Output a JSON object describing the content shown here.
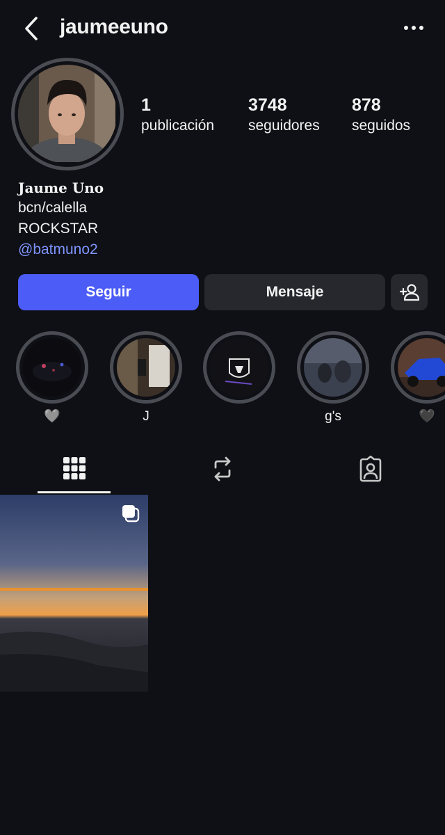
{
  "header": {
    "username": "jaumeeuno",
    "back_icon": "chevron-left-icon",
    "more_icon": "more-horizontal-icon"
  },
  "stats": {
    "posts_count": "1",
    "posts_label": "publicación",
    "followers_count": "3748",
    "followers_label": "seguidores",
    "following_count": "878",
    "following_label": "seguidos"
  },
  "bio": {
    "name": "Jaume Uno",
    "line1": "bcn/calella",
    "line2": "ROCKSTAR",
    "link": "@batmuno2"
  },
  "actions": {
    "follow_label": "Seguir",
    "message_label": "Mensaje",
    "add_user_icon": "add-user-icon"
  },
  "highlights": [
    {
      "label": "🩶"
    },
    {
      "label": "J"
    },
    {
      "label": ""
    },
    {
      "label": "g's"
    },
    {
      "label": "🖤"
    }
  ],
  "tabs": {
    "items": [
      "grid-icon",
      "reels-repost-icon",
      "tagged-icon"
    ],
    "active": "grid-icon"
  },
  "posts": [
    {
      "type": "carousel",
      "subject": "sunset over sea"
    }
  ],
  "colors": {
    "background": "#0f1015",
    "accent": "#4c5cf6",
    "link": "#7e95ff",
    "secondary_button": "#26282e"
  }
}
